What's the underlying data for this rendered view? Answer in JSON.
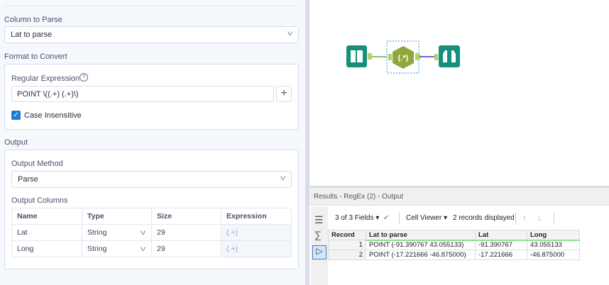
{
  "config": {
    "column_to_parse_label": "Column to Parse",
    "column_to_parse_value": "Lat to parse",
    "format_label": "Format to Convert",
    "regex_label": "Regular Expression",
    "regex_value": "POINT \\((.+) (.+)\\)",
    "add_label": "+",
    "case_insensitive_label": "Case Insensitive",
    "case_insensitive_checked": true,
    "output_label": "Output",
    "output_method_label": "Output Method",
    "output_method_value": "Parse",
    "output_columns_label": "Output Columns",
    "columns_headers": [
      "Name",
      "Type",
      "Size",
      "Expression"
    ],
    "columns_rows": [
      [
        "Lat",
        "String",
        "29",
        "(.+)"
      ],
      [
        "Long",
        "String",
        "29",
        "(.+)"
      ]
    ]
  },
  "results": {
    "title": "Results - RegEx (2) - Output",
    "fields": "3 of 3 Fields",
    "viewer": "Cell Viewer",
    "records": "2 records displayed",
    "headers": [
      "Record",
      "Lat to parse",
      "Lat",
      "Long"
    ],
    "rows": [
      [
        "1",
        "POINT (-91.390767 43.055133)",
        "-91.390767",
        "43.055133"
      ],
      [
        "2",
        "POINT (-17.221666 -46.875000)",
        "-17.221666",
        "-46.875000"
      ]
    ]
  },
  "colors": {
    "accent": "#1a7fd4",
    "tool_teal": "#14907a",
    "regex_green": "#8ea63a"
  }
}
